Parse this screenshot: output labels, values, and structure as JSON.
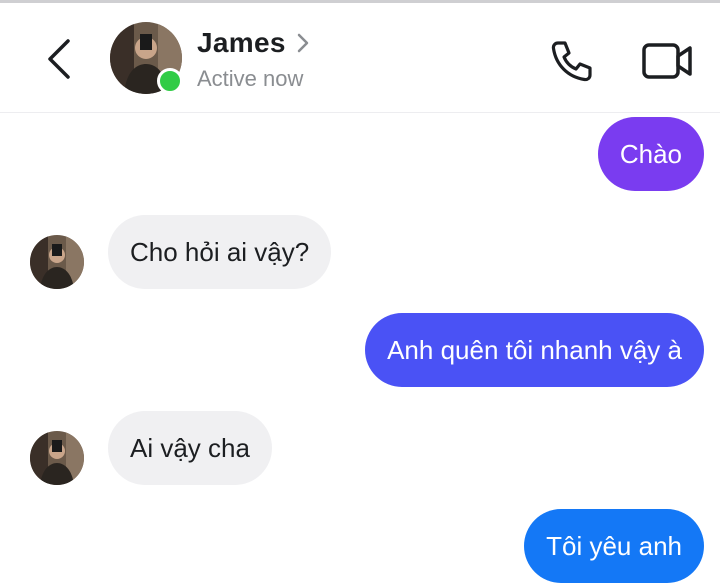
{
  "header": {
    "contact_name": "James",
    "status": "Active now",
    "icons": {
      "back": "back-chevron-icon",
      "profile_chevron": "chevron-right-icon",
      "call": "phone-icon",
      "video": "video-camera-icon"
    },
    "online_color": "#31cc46"
  },
  "messages": [
    {
      "side": "me",
      "text": "Chào",
      "color": "#7a3cf0"
    },
    {
      "side": "them",
      "text": "Cho hỏi ai vậy?"
    },
    {
      "side": "me",
      "text": "Anh quên tôi nhanh vậy à",
      "color": "#4a52f5"
    },
    {
      "side": "them",
      "text": "Ai vậy cha"
    },
    {
      "side": "me",
      "text": "Tôi yêu anh",
      "color": "#1478f6"
    }
  ]
}
